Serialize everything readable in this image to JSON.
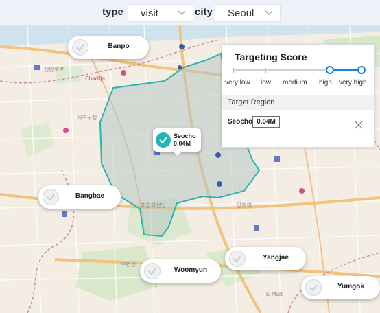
{
  "filters": {
    "type_label": "type",
    "type_value": "visit",
    "city_label": "city",
    "city_value": "Seoul"
  },
  "score_panel": {
    "title": "Targeting Score",
    "levels": [
      "very low",
      "low",
      "medium",
      "high",
      "very high"
    ],
    "selected_range": [
      "high",
      "very high"
    ],
    "target_region_label": "Target Region",
    "target_name": "Seocho",
    "target_value": "0.04M"
  },
  "selected_marker": {
    "name": "Seocho",
    "value": "0.04M"
  },
  "districts": [
    {
      "name": "Banpo"
    },
    {
      "name": "Bangbae"
    },
    {
      "name": "Yangjae"
    },
    {
      "name": "Woomyun"
    },
    {
      "name": "Yumgok"
    }
  ],
  "map_labels": {
    "a": "Chadilja",
    "b": "신반포로",
    "c": "예술의전당",
    "d": "양재역",
    "e": "E-Mart",
    "f": "서초구청",
    "g": "우면산"
  },
  "colors": {
    "accent": "#1d7fd6",
    "region_outline": "#28b5b0",
    "check_selected": "#1fb6b4",
    "map_land": "#f4ede4",
    "map_water": "#cfe3ee"
  }
}
